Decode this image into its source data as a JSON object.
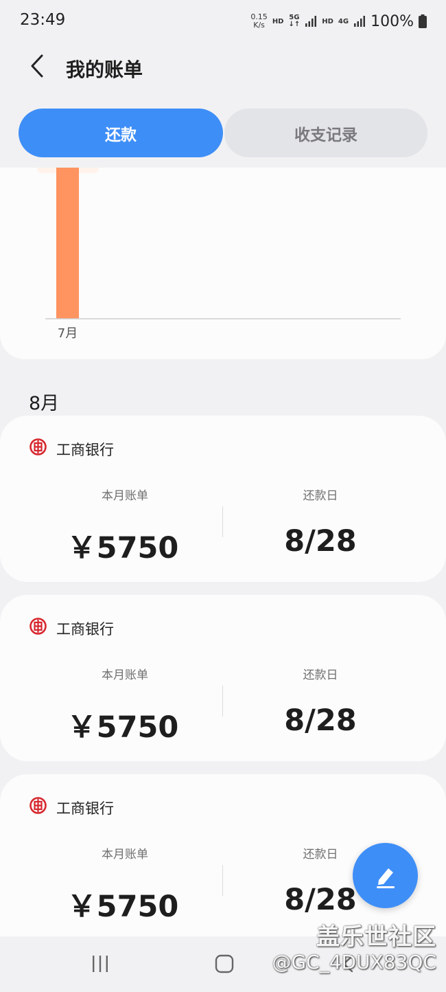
{
  "status_bar": {
    "time": "23:49",
    "net_speed_value": "0.15",
    "net_speed_unit": "K/s",
    "hd_1": "HD",
    "network_5g": "5G",
    "hd_2": "HD",
    "network_4g": "4G",
    "battery": "100%"
  },
  "header": {
    "title": "我的账单",
    "back_icon": "chevron-left-icon"
  },
  "tabs": [
    {
      "label": "还款",
      "active": true
    },
    {
      "label": "收支记录",
      "active": false
    }
  ],
  "chart_data": {
    "type": "bar",
    "categories": [
      "7月"
    ],
    "values": [
      5750
    ],
    "color": "#ff9460",
    "title": "",
    "xlabel": "",
    "ylabel": ""
  },
  "month_heading": "8月",
  "bills": [
    {
      "bank": "工商银行",
      "bill_label": "本月账单",
      "amount": "￥5750",
      "due_label": "还款日",
      "due_date": "8/28"
    },
    {
      "bank": "工商银行",
      "bill_label": "本月账单",
      "amount": "￥5750",
      "due_label": "还款日",
      "due_date": "8/28"
    },
    {
      "bank": "工商银行",
      "bill_label": "本月账单",
      "amount": "￥5750",
      "due_label": "还款日",
      "due_date": "8/28"
    }
  ],
  "fab_icon": "edit-icon",
  "watermark": {
    "line1": "盖乐世社区",
    "line2": "@GC_4DUX83QC"
  },
  "colors": {
    "accent": "#3e8ef7",
    "bank_red": "#d7262e",
    "bar": "#ff9460"
  }
}
